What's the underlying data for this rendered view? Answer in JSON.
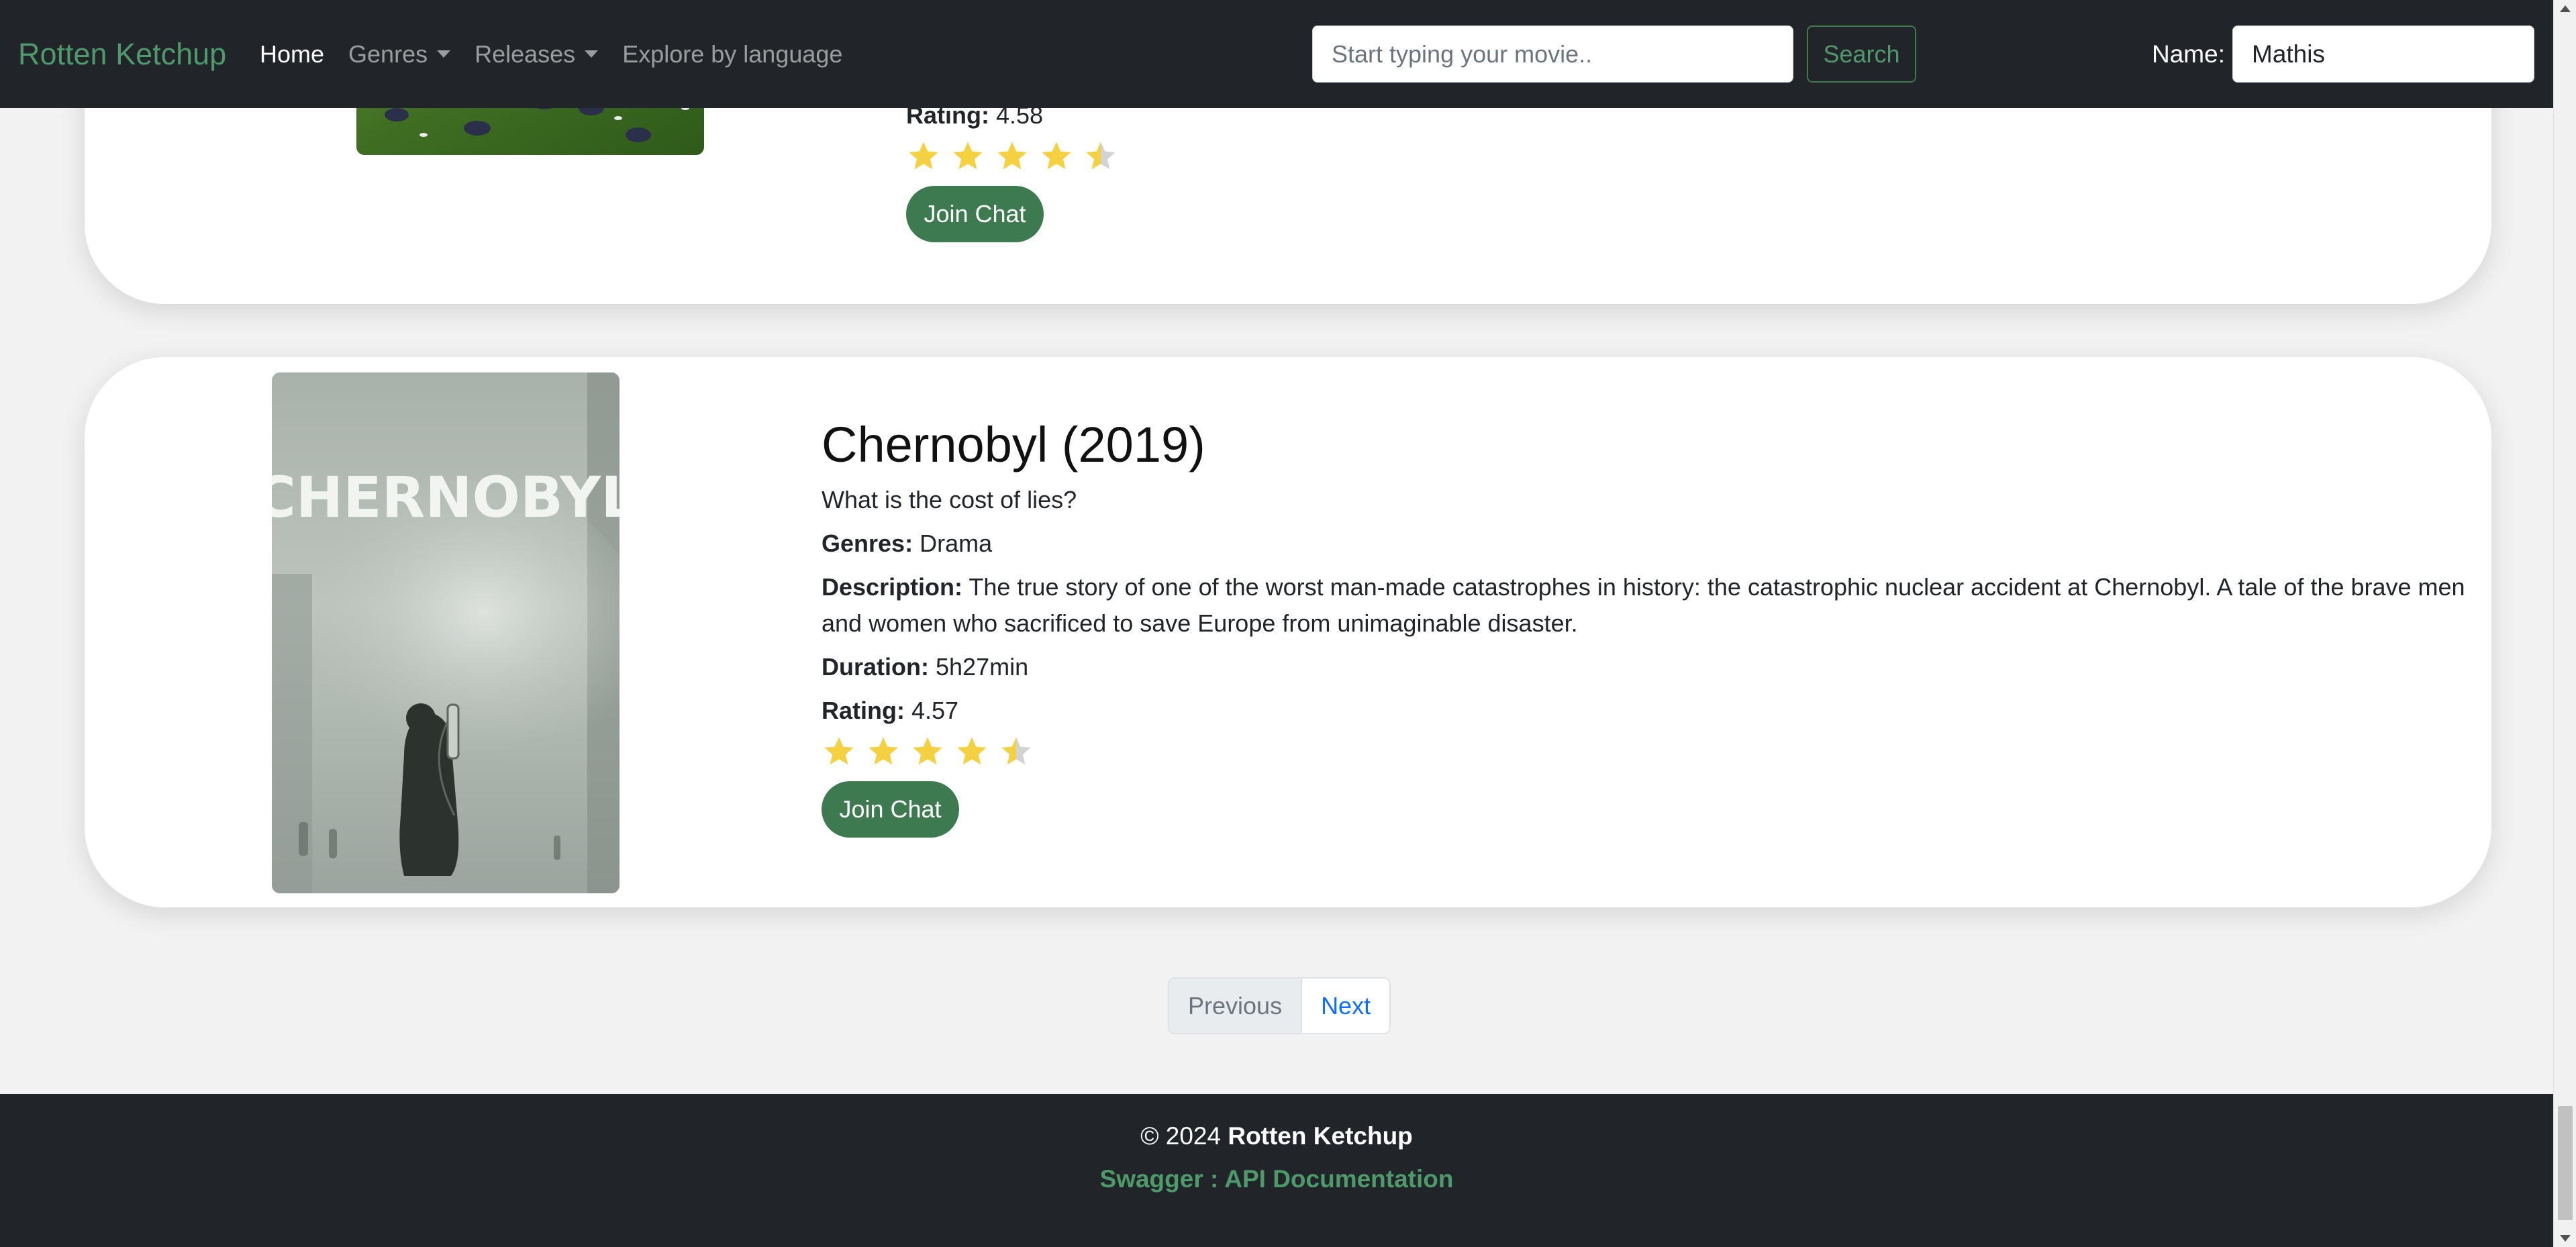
{
  "navbar": {
    "brand": "Rotten Ketchup",
    "links": {
      "home": "Home",
      "genres": "Genres",
      "releases": "Releases",
      "explore": "Explore by language"
    },
    "search": {
      "placeholder": "Start typing your movie..",
      "button": "Search"
    },
    "name": {
      "label": "Name:",
      "value": "Mathis"
    }
  },
  "movies": [
    {
      "rating_label": "Rating:",
      "rating": "4.58",
      "stars_filled": 4.5,
      "join": "Join Chat"
    },
    {
      "title": "Chernobyl (2019)",
      "tagline": "What is the cost of lies?",
      "genres_label": "Genres:",
      "genres": "Drama",
      "description_label": "Description:",
      "description": "The true story of one of the worst man-made catastrophes in history: the catastrophic nuclear accident at Chernobyl. A tale of the brave men and women who sacrificed to save Europe from unimaginable disaster.",
      "duration_label": "Duration:",
      "duration": "5h27min",
      "rating_label": "Rating:",
      "rating": "4.57",
      "stars_filled": 4.5,
      "poster_text": "CHERNOBYL",
      "join": "Join Chat"
    }
  ],
  "pagination": {
    "previous": "Previous",
    "next": "Next"
  },
  "footer": {
    "copyright_prefix": "© 2024",
    "brand": "Rotten Ketchup",
    "api_link": "Swagger : API Documentation"
  },
  "colors": {
    "navbar_bg": "#212529",
    "accent_green": "#3d7a4f",
    "star_gold": "#f5d142",
    "link_blue": "#0d6efd"
  }
}
